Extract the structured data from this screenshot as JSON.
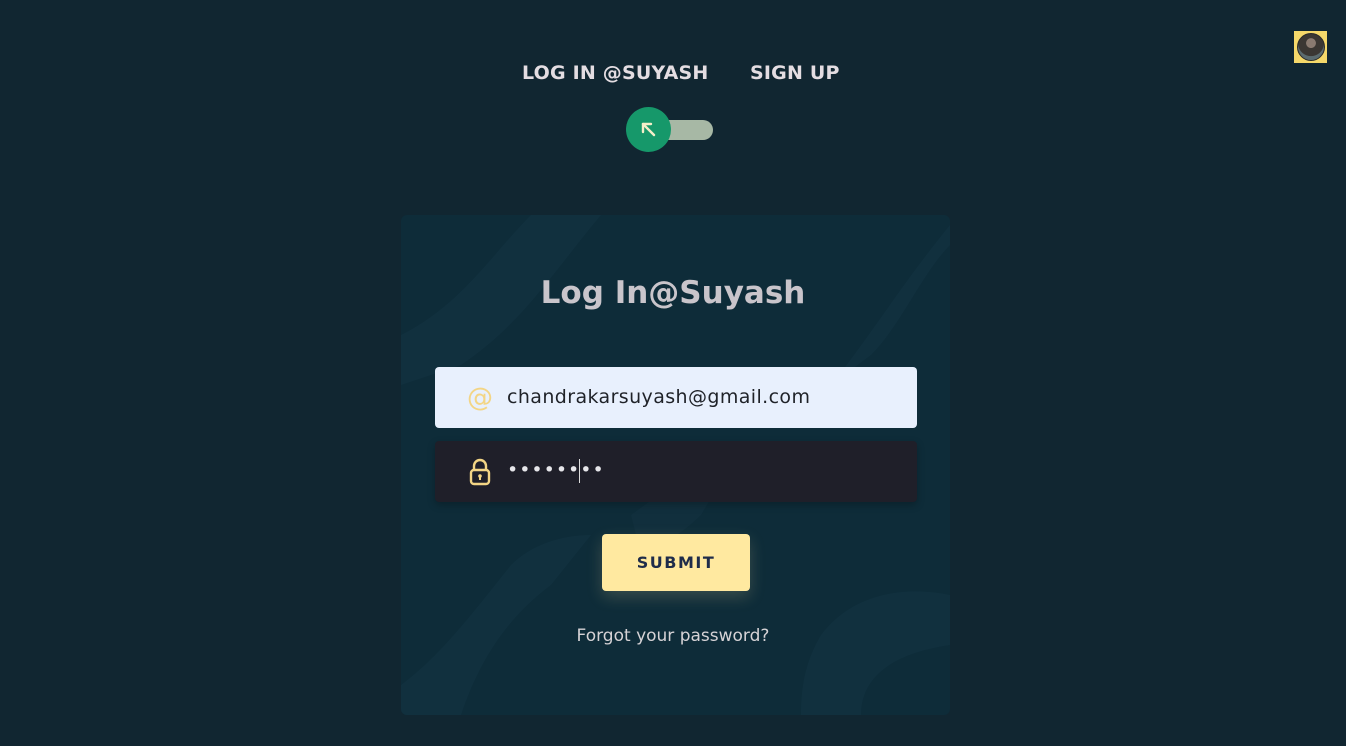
{
  "nav": {
    "login_tab": "LOG IN @SUYASH",
    "signup_tab": "SIGN UP",
    "toggle_icon": "arrow-up-left-icon"
  },
  "avatar": {
    "icon": "profile-avatar"
  },
  "form": {
    "title": "Log In@Suyash",
    "email": {
      "icon": "at-icon",
      "value": "chandrakarsuyash@gmail.com"
    },
    "password": {
      "icon": "lock-icon",
      "value": "••••••••"
    },
    "submit_label": "SUBMIT",
    "forgot_label": "Forgot your password?"
  },
  "colors": {
    "background": "#112631",
    "card": "#0e2c39",
    "accent_yellow": "#ffe9a0",
    "toggle_knob": "#16986a",
    "toggle_track": "#a7b8a5"
  }
}
